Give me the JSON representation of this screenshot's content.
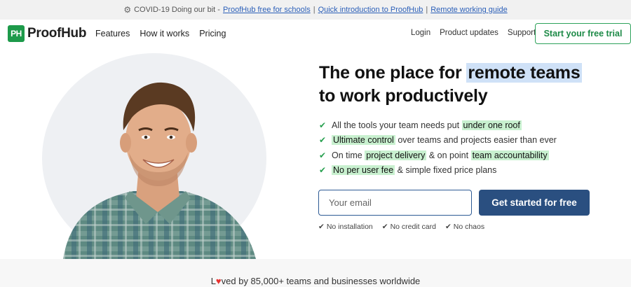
{
  "announcement": {
    "icon": "gear-icon",
    "prefix": "COVID-19 Doing our bit -",
    "links": [
      "ProofHub free for schools",
      "Quick introduction to ProofHub",
      "Remote working guide"
    ],
    "separator": "|"
  },
  "brand": {
    "mark": "PH",
    "name": "ProofHub",
    "color": "#1d9a4a"
  },
  "nav": {
    "left": [
      "Features",
      "How it works",
      "Pricing"
    ],
    "right": [
      "Login",
      "Product updates",
      "Support"
    ],
    "trial_button": "Start your free trial"
  },
  "hero": {
    "headline_part1": "The one place for",
    "headline_highlight": "remote teams",
    "headline_part2": "to work productively",
    "features": [
      {
        "before": "All the tools your team needs put",
        "highlight": "under one roof",
        "after": ""
      },
      {
        "before": "",
        "highlight": "Ultimate control",
        "after": "over teams and projects easier than ever"
      },
      {
        "before": "On time",
        "highlight": "project delivery",
        "after": "& on point",
        "highlight2": "team accountability"
      },
      {
        "before": "",
        "highlight": "No per user fee",
        "after": "& simple fixed price plans"
      }
    ],
    "email_placeholder": "Your email",
    "cta": "Get started for free",
    "notes": [
      "No installation",
      "No credit card",
      "No chaos"
    ]
  },
  "footer": {
    "before_heart": "L",
    "after_heart": "ved by 85,000+ teams and businesses worldwide"
  },
  "colors": {
    "accent_green": "#28a050",
    "cta_blue": "#2a4f80",
    "highlight_blue": "#cfe1f7",
    "highlight_green": "#c8f0cf"
  }
}
